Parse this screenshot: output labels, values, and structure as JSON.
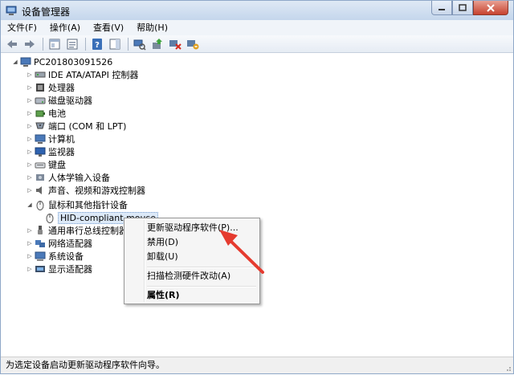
{
  "window": {
    "title": "设备管理器",
    "accent": "#e53b2f"
  },
  "menubar": {
    "items": [
      "文件(F)",
      "操作(A)",
      "查看(V)",
      "帮助(H)"
    ]
  },
  "toolbar": {
    "icons": [
      "back-arrow-icon",
      "forward-arrow-icon",
      "properties-window-icon",
      "show-hidden-icon",
      "help-icon",
      "action-pane-icon",
      "scan-hardware-icon",
      "update-driver-icon",
      "disable-device-icon",
      "uninstall-device-icon"
    ]
  },
  "tree": {
    "root": "PC201803091526",
    "categories": [
      {
        "label": "IDE ATA/ATAPI 控制器",
        "icon": "ide-controller-icon"
      },
      {
        "label": "处理器",
        "icon": "processor-icon"
      },
      {
        "label": "磁盘驱动器",
        "icon": "disk-drive-icon"
      },
      {
        "label": "电池",
        "icon": "battery-icon"
      },
      {
        "label": "端口 (COM 和 LPT)",
        "icon": "port-icon"
      },
      {
        "label": "计算机",
        "icon": "computer-icon"
      },
      {
        "label": "监视器",
        "icon": "monitor-icon"
      },
      {
        "label": "键盘",
        "icon": "keyboard-icon"
      },
      {
        "label": "人体学输入设备",
        "icon": "hid-icon"
      },
      {
        "label": "声音、视频和游戏控制器",
        "icon": "sound-icon"
      },
      {
        "label": "鼠标和其他指针设备",
        "icon": "mouse-icon"
      },
      {
        "label": "通用串行总线控制器",
        "icon": "usb-icon"
      },
      {
        "label": "网络适配器",
        "icon": "network-adapter-icon"
      },
      {
        "label": "系统设备",
        "icon": "system-device-icon"
      },
      {
        "label": "显示适配器",
        "icon": "display-adapter-icon"
      }
    ],
    "child_device": "HID-compliant mouse"
  },
  "context_menu": {
    "update_driver": "更新驱动程序软件(P)...",
    "disable": "禁用(D)",
    "uninstall": "卸载(U)",
    "scan": "扫描检测硬件改动(A)",
    "properties": "属性(R)"
  },
  "statusbar": {
    "text": "为选定设备启动更新驱动程序软件向导。"
  }
}
